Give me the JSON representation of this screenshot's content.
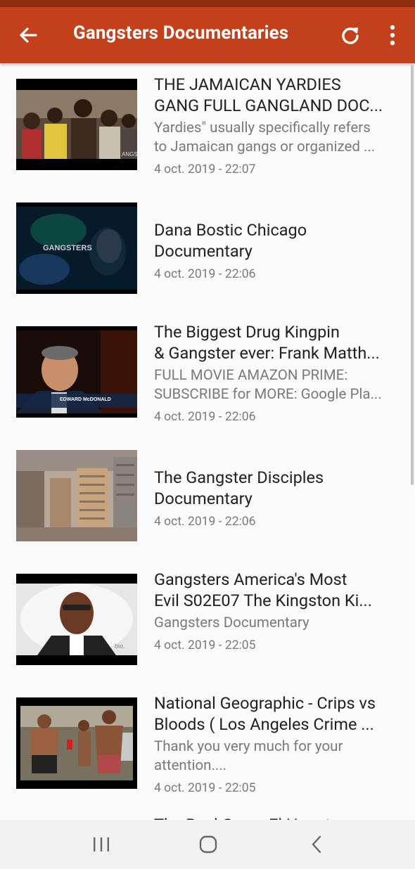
{
  "app_bar": {
    "title": "Gangsters Documentaries",
    "back_icon": "arrow-left-icon",
    "refresh_icon": "refresh-icon",
    "more_icon": "more-vertical-icon",
    "color": "#c3401a"
  },
  "videos": [
    {
      "title_1": "THE JAMAICAN YARDIES",
      "title_2": "GANG FULL GANGLAND DOC...",
      "desc_1": "Yardies\" usually specifically refers",
      "desc_2": "to Jamaican gangs or organized ...",
      "date": "4 oct. 2019 - 22:07"
    },
    {
      "title_1": "Dana Bostic Chicago",
      "title_2": "Documentary",
      "date": "4 oct. 2019 - 22:06",
      "thumb_text": "GANGSTERS"
    },
    {
      "title_1": "The Biggest Drug Kingpin",
      "title_2": "& Gangster ever: Frank Matth...",
      "desc_1": "FULL MOVIE AMAZON PRIME:",
      "desc_2": "SUBSCRIBE for MORE: Google Pla...",
      "date": "4 oct. 2019 - 22:06",
      "thumb_text": "EDWARD McDONALD"
    },
    {
      "title_1": "The Gangster Disciples",
      "title_2": "Documentary",
      "date": "4 oct. 2019 - 22:06"
    },
    {
      "title_1": "Gangsters  America's Most",
      "title_2": "Evil  S02E07 The Kingston Ki...",
      "desc_1": "Gangsters Documentary",
      "date": "4 oct. 2019 - 22:05",
      "thumb_text": "bio."
    },
    {
      "title_1": "National Geographic - Crips vs",
      "title_2": "Bloods ( Los Angeles Crime ...",
      "desc_1": "Thank you very much for your",
      "desc_2": "attention....",
      "date": "4 oct. 2019 - 22:05"
    },
    {
      "title_1": "The Real Gang: El Haunt..."
    }
  ],
  "nav": {
    "recents_icon": "recent-apps-icon",
    "home_icon": "home-icon",
    "back_icon": "nav-back-icon"
  }
}
